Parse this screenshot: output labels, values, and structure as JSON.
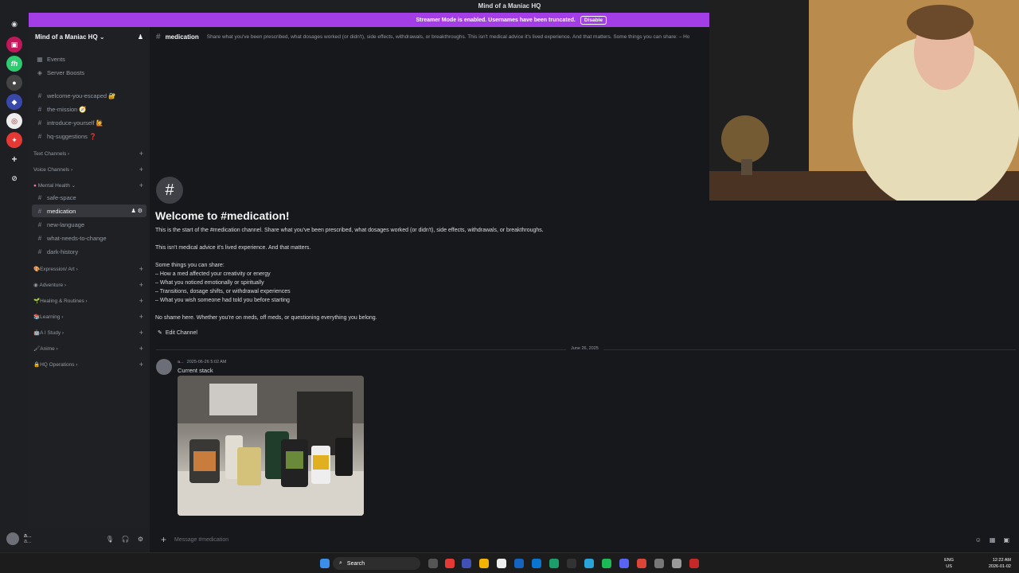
{
  "window": {
    "title": "Mind of a Maniac HQ"
  },
  "banner": {
    "text": "Streamer Mode is enabled. Usernames have been truncated.",
    "disable_label": "Disable"
  },
  "server": {
    "name": "Mind of a Maniac HQ"
  },
  "sidebar": {
    "top_items": [
      {
        "label": "Events",
        "icon": "calendar-icon"
      },
      {
        "label": "Server Boosts",
        "icon": "boost-icon"
      }
    ],
    "pinned_channels": [
      "welcome-you-escaped 🔐",
      "the-mission 🧭",
      "introduce-yourself 🙋",
      "hq-suggestions ❓"
    ],
    "categories_top": [
      "Text Channels",
      "Voice Channels"
    ],
    "mental_health": {
      "label": "Mental Health",
      "channels": [
        "safe-space",
        "medication",
        "new-language",
        "what-needs-to-change",
        "dark-history"
      ],
      "active": "medication"
    },
    "categories_bottom": [
      "Expression/ Art",
      "Adventure",
      "Healing & Routines",
      "Learning",
      "A I Study",
      "Anime",
      "HQ Operations"
    ]
  },
  "channel": {
    "name": "medication",
    "topic": "Share what you've been prescribed, what dosages worked (or didn't), side effects, withdrawals, or breakthroughs. This isn't medical advice it's lived experience. And that matters. Some things you can share: – Ho"
  },
  "welcome": {
    "title": "Welcome to #medication!",
    "line1": "This is the start of the #medication channel. Share what you've been prescribed, what dosages worked (or didn't), side effects, withdrawals, or breakthroughs.",
    "line2": "This isn't medical advice it's lived experience. And that matters.",
    "line3": "Some things you can share:",
    "bullets": [
      "– How a med affected your creativity or energy",
      "– What you noticed emotionally or spiritually",
      "– Transitions, dosage shifts, or withdrawal experiences",
      "– What you wish someone had told you before starting"
    ],
    "line4": "No shame here. Whether you're on meds, off meds, or questioning everything  you belong.",
    "edit_label": "Edit Channel"
  },
  "messages": {
    "date": "June 26, 2025",
    "author": "a...",
    "timestamp": "2025-06-26 5:02 AM",
    "text": "Current stack"
  },
  "composer": {
    "placeholder": "Message #medication"
  },
  "user": {
    "name": "a...",
    "status": "a..."
  },
  "taskbar": {
    "search": "Search",
    "lang1": "ENG",
    "lang2": "US",
    "time": "12:22 AM",
    "date": "2026-01-02"
  },
  "colors": {
    "banner": "#a33de6",
    "background": "#17181b",
    "sidebar": "#1f2023"
  }
}
